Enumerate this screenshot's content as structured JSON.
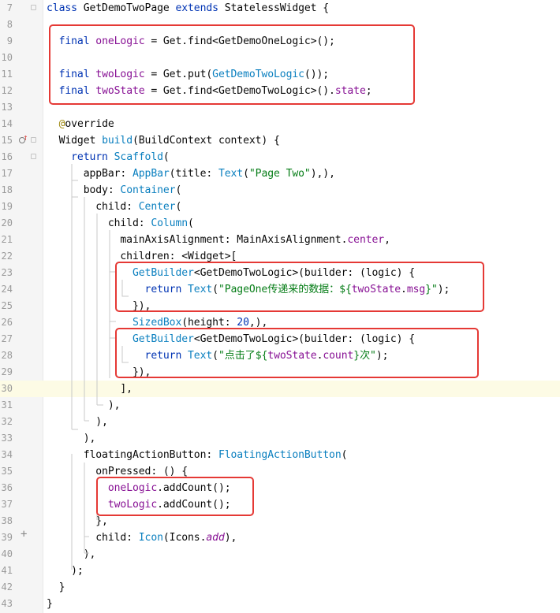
{
  "editor": {
    "lines": [
      {
        "n": "7",
        "current": false,
        "tokens": [
          {
            "t": "class ",
            "c": "kw"
          },
          {
            "t": "GetDemoTwoPage ",
            "c": ""
          },
          {
            "t": "extends ",
            "c": "kw"
          },
          {
            "t": "StatelessWidget {",
            "c": ""
          }
        ]
      },
      {
        "n": "8",
        "current": false,
        "tokens": []
      },
      {
        "n": "9",
        "current": false,
        "tokens": [
          {
            "t": "  ",
            "c": ""
          },
          {
            "t": "final ",
            "c": "kw"
          },
          {
            "t": "oneLogic",
            "c": "fld"
          },
          {
            "t": " = Get.find<GetDemoOneLogic>();",
            "c": ""
          }
        ]
      },
      {
        "n": "10",
        "current": false,
        "tokens": []
      },
      {
        "n": "11",
        "current": false,
        "tokens": [
          {
            "t": "  ",
            "c": ""
          },
          {
            "t": "final ",
            "c": "kw"
          },
          {
            "t": "twoLogic",
            "c": "fld"
          },
          {
            "t": " = Get.put(",
            "c": ""
          },
          {
            "t": "GetDemoTwoLogic",
            "c": "cls"
          },
          {
            "t": "());",
            "c": ""
          }
        ]
      },
      {
        "n": "12",
        "current": false,
        "tokens": [
          {
            "t": "  ",
            "c": ""
          },
          {
            "t": "final ",
            "c": "kw"
          },
          {
            "t": "twoState",
            "c": "fld"
          },
          {
            "t": " = Get.find<GetDemoTwoLogic>().",
            "c": ""
          },
          {
            "t": "state",
            "c": "fld"
          },
          {
            "t": ";",
            "c": ""
          }
        ]
      },
      {
        "n": "13",
        "current": false,
        "tokens": []
      },
      {
        "n": "14",
        "current": false,
        "tokens": [
          {
            "t": "  ",
            "c": ""
          },
          {
            "t": "@",
            "c": "ann"
          },
          {
            "t": "override",
            "c": ""
          }
        ]
      },
      {
        "n": "15",
        "current": false,
        "tokens": [
          {
            "t": "  Widget ",
            "c": ""
          },
          {
            "t": "build",
            "c": "cls"
          },
          {
            "t": "(BuildContext context) {",
            "c": ""
          }
        ]
      },
      {
        "n": "16",
        "current": false,
        "tokens": [
          {
            "t": "    ",
            "c": ""
          },
          {
            "t": "return ",
            "c": "kw"
          },
          {
            "t": "Scaffold",
            "c": "cls"
          },
          {
            "t": "(",
            "c": ""
          }
        ]
      },
      {
        "n": "17",
        "current": false,
        "tokens": [
          {
            "t": "      appBar: ",
            "c": ""
          },
          {
            "t": "AppBar",
            "c": "cls"
          },
          {
            "t": "(title: ",
            "c": ""
          },
          {
            "t": "Text",
            "c": "cls"
          },
          {
            "t": "(",
            "c": ""
          },
          {
            "t": "\"Page Two\"",
            "c": "str"
          },
          {
            "t": "),),",
            "c": ""
          }
        ]
      },
      {
        "n": "18",
        "current": false,
        "tokens": [
          {
            "t": "      body: ",
            "c": ""
          },
          {
            "t": "Container",
            "c": "cls"
          },
          {
            "t": "(",
            "c": ""
          }
        ]
      },
      {
        "n": "19",
        "current": false,
        "tokens": [
          {
            "t": "        child: ",
            "c": ""
          },
          {
            "t": "Center",
            "c": "cls"
          },
          {
            "t": "(",
            "c": ""
          }
        ]
      },
      {
        "n": "20",
        "current": false,
        "tokens": [
          {
            "t": "          child: ",
            "c": ""
          },
          {
            "t": "Column",
            "c": "cls"
          },
          {
            "t": "(",
            "c": ""
          }
        ]
      },
      {
        "n": "21",
        "current": false,
        "tokens": [
          {
            "t": "            mainAxisAlignment: MainAxisAlignment.",
            "c": ""
          },
          {
            "t": "center",
            "c": "fld"
          },
          {
            "t": ",",
            "c": ""
          }
        ]
      },
      {
        "n": "22",
        "current": false,
        "tokens": [
          {
            "t": "            children: <Widget>[",
            "c": ""
          }
        ]
      },
      {
        "n": "23",
        "current": false,
        "tokens": [
          {
            "t": "              ",
            "c": ""
          },
          {
            "t": "GetBuilder",
            "c": "cls"
          },
          {
            "t": "<GetDemoTwoLogic>(builder: (logic) {",
            "c": ""
          }
        ]
      },
      {
        "n": "24",
        "current": false,
        "tokens": [
          {
            "t": "                ",
            "c": ""
          },
          {
            "t": "return ",
            "c": "kw"
          },
          {
            "t": "Text",
            "c": "cls"
          },
          {
            "t": "(",
            "c": ""
          },
          {
            "t": "\"PageOne传递来的数据：${",
            "c": "str"
          },
          {
            "t": "twoState",
            "c": "fld"
          },
          {
            "t": ".",
            "c": ""
          },
          {
            "t": "msg",
            "c": "fld"
          },
          {
            "t": "}\"",
            "c": "str"
          },
          {
            "t": ");",
            "c": ""
          }
        ]
      },
      {
        "n": "25",
        "current": false,
        "tokens": [
          {
            "t": "              }),",
            "c": ""
          }
        ]
      },
      {
        "n": "26",
        "current": false,
        "tokens": [
          {
            "t": "              ",
            "c": ""
          },
          {
            "t": "SizedBox",
            "c": "cls"
          },
          {
            "t": "(height: ",
            "c": ""
          },
          {
            "t": "20",
            "c": "kw"
          },
          {
            "t": ",),",
            "c": ""
          }
        ]
      },
      {
        "n": "27",
        "current": false,
        "tokens": [
          {
            "t": "              ",
            "c": ""
          },
          {
            "t": "GetBuilder",
            "c": "cls"
          },
          {
            "t": "<GetDemoTwoLogic>(builder: (logic) {",
            "c": ""
          }
        ]
      },
      {
        "n": "28",
        "current": false,
        "tokens": [
          {
            "t": "                ",
            "c": ""
          },
          {
            "t": "return ",
            "c": "kw"
          },
          {
            "t": "Text",
            "c": "cls"
          },
          {
            "t": "(",
            "c": ""
          },
          {
            "t": "\"点击了${",
            "c": "str"
          },
          {
            "t": "twoState",
            "c": "fld"
          },
          {
            "t": ".",
            "c": ""
          },
          {
            "t": "count",
            "c": "fld"
          },
          {
            "t": "}次\"",
            "c": "str"
          },
          {
            "t": ");",
            "c": ""
          }
        ]
      },
      {
        "n": "29",
        "current": false,
        "tokens": [
          {
            "t": "              }),",
            "c": ""
          }
        ]
      },
      {
        "n": "30",
        "current": true,
        "tokens": [
          {
            "t": "            ],",
            "c": ""
          }
        ]
      },
      {
        "n": "31",
        "current": false,
        "tokens": [
          {
            "t": "          ),",
            "c": ""
          }
        ]
      },
      {
        "n": "32",
        "current": false,
        "tokens": [
          {
            "t": "        ),",
            "c": ""
          }
        ]
      },
      {
        "n": "33",
        "current": false,
        "tokens": [
          {
            "t": "      ),",
            "c": ""
          }
        ]
      },
      {
        "n": "34",
        "current": false,
        "tokens": [
          {
            "t": "      floatingActionButton: ",
            "c": ""
          },
          {
            "t": "FloatingActionButton",
            "c": "cls"
          },
          {
            "t": "(",
            "c": ""
          }
        ]
      },
      {
        "n": "35",
        "current": false,
        "tokens": [
          {
            "t": "        onPressed: () {",
            "c": ""
          }
        ]
      },
      {
        "n": "36",
        "current": false,
        "tokens": [
          {
            "t": "          ",
            "c": ""
          },
          {
            "t": "oneLogic",
            "c": "fld"
          },
          {
            "t": ".addCount();",
            "c": ""
          }
        ]
      },
      {
        "n": "37",
        "current": false,
        "tokens": [
          {
            "t": "          ",
            "c": ""
          },
          {
            "t": "twoLogic",
            "c": "fld"
          },
          {
            "t": ".addCount();",
            "c": ""
          }
        ]
      },
      {
        "n": "38",
        "current": false,
        "tokens": [
          {
            "t": "        },",
            "c": ""
          }
        ]
      },
      {
        "n": "39",
        "current": false,
        "tokens": [
          {
            "t": "        child: ",
            "c": ""
          },
          {
            "t": "Icon",
            "c": "cls"
          },
          {
            "t": "(Icons.",
            "c": ""
          },
          {
            "t": "add",
            "c": "fld it"
          },
          {
            "t": "),",
            "c": ""
          }
        ]
      },
      {
        "n": "40",
        "current": false,
        "tokens": [
          {
            "t": "      ),",
            "c": ""
          }
        ]
      },
      {
        "n": "41",
        "current": false,
        "tokens": [
          {
            "t": "    );",
            "c": ""
          }
        ]
      },
      {
        "n": "42",
        "current": false,
        "tokens": [
          {
            "t": "  }",
            "c": ""
          }
        ]
      },
      {
        "n": "43",
        "current": false,
        "tokens": [
          {
            "t": "}",
            "c": ""
          }
        ]
      }
    ]
  },
  "gutter_icons": {
    "override_marker": "override-marker-icon",
    "add_line": "plus-icon"
  },
  "colors": {
    "highlight": "#e53935",
    "keyword": "#0033b3",
    "field": "#871094",
    "class": "#0a7fbf",
    "string": "#067d17"
  }
}
